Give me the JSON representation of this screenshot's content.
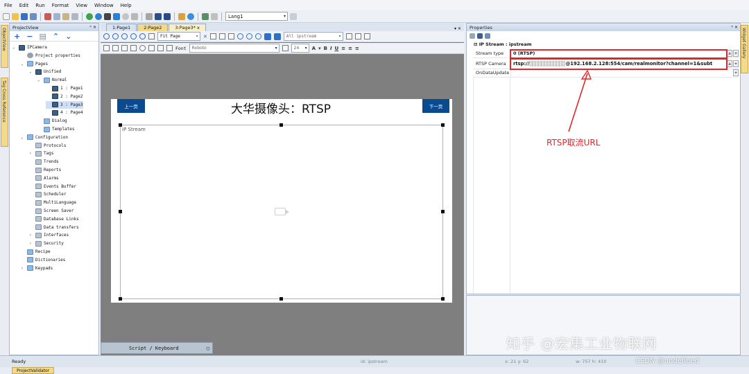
{
  "menu": [
    "File",
    "Edit",
    "Run",
    "Format",
    "View",
    "Window",
    "Help"
  ],
  "toolbar": {
    "language": "Lang1"
  },
  "side_tabs": {
    "left1": "ObjectView",
    "left2": "Tag Cross Reference",
    "right": "Widget Gallery"
  },
  "project_panel": {
    "title": "ProjectView",
    "tree": [
      {
        "label": "IPCamera",
        "level": 0,
        "exp": "v",
        "icon": "project-icon"
      },
      {
        "label": "Project properties",
        "level": 1,
        "exp": "",
        "icon": "gear-icon"
      },
      {
        "label": "Pages",
        "level": 1,
        "exp": "v",
        "icon": "folder-icon"
      },
      {
        "label": "Unified",
        "level": 2,
        "exp": "v",
        "icon": "page-group-icon"
      },
      {
        "label": "Normal",
        "level": 3,
        "exp": "v",
        "icon": "folder-icon"
      },
      {
        "label": "1 : Page1",
        "level": 4,
        "exp": "",
        "icon": "home-icon"
      },
      {
        "label": "2 : Page2",
        "level": 4,
        "exp": "",
        "icon": "page-icon"
      },
      {
        "label": "3 : Page3",
        "level": 4,
        "exp": "",
        "icon": "page-icon",
        "selected": true
      },
      {
        "label": "4 : Page4",
        "level": 4,
        "exp": "",
        "icon": "page-icon"
      },
      {
        "label": "Dialog",
        "level": 3,
        "exp": "",
        "icon": "folder-icon"
      },
      {
        "label": "Templates",
        "level": 3,
        "exp": "",
        "icon": "folder-icon"
      },
      {
        "label": "Configuration",
        "level": 1,
        "exp": "v",
        "icon": "folder-icon"
      },
      {
        "label": "Protocols",
        "level": 2,
        "exp": "",
        "icon": "protocols-icon"
      },
      {
        "label": "Tags",
        "level": 2,
        "exp": ">",
        "icon": "tags-icon"
      },
      {
        "label": "Trends",
        "level": 2,
        "exp": "",
        "icon": "trends-icon"
      },
      {
        "label": "Reports",
        "level": 2,
        "exp": "",
        "icon": "reports-icon"
      },
      {
        "label": "Alarms",
        "level": 2,
        "exp": "",
        "icon": "alarms-icon"
      },
      {
        "label": "Events Buffer",
        "level": 2,
        "exp": "",
        "icon": "events-icon"
      },
      {
        "label": "Scheduler",
        "level": 2,
        "exp": "",
        "icon": "scheduler-icon"
      },
      {
        "label": "MultiLanguage",
        "level": 2,
        "exp": "",
        "icon": "multilanguage-icon"
      },
      {
        "label": "Screen Saver",
        "level": 2,
        "exp": "",
        "icon": "screensaver-icon"
      },
      {
        "label": "Database Links",
        "level": 2,
        "exp": "",
        "icon": "database-icon"
      },
      {
        "label": "Data transfers",
        "level": 2,
        "exp": "",
        "icon": "datatransfer-icon"
      },
      {
        "label": "Interfaces",
        "level": 2,
        "exp": ">",
        "icon": "interfaces-icon"
      },
      {
        "label": "Security",
        "level": 2,
        "exp": ">",
        "icon": "security-icon"
      },
      {
        "label": "Recipe",
        "level": 1,
        "exp": "",
        "icon": "folder-icon"
      },
      {
        "label": "Dictionaries",
        "level": 1,
        "exp": "",
        "icon": "folder-icon"
      },
      {
        "label": "Keypads",
        "level": 1,
        "exp": ">",
        "icon": "folder-icon"
      }
    ]
  },
  "editor": {
    "tabs": [
      {
        "label": "1:Page1",
        "bg": "#d6e2f0"
      },
      {
        "label": "2:Page2",
        "bg": "#f3d98b"
      },
      {
        "label": "3:Page3*",
        "bg": "#f7efc9",
        "close": "x"
      }
    ],
    "zoom": "Fit Page",
    "layer": "All ipstream",
    "font_label": "Font",
    "font_name": "Roboto",
    "font_size": "24",
    "page": {
      "title": "大华摄像头：RTSP",
      "prev_button": "上一页",
      "next_button": "下一页",
      "widget_label": "IP Stream"
    },
    "script_bar": "Script / Keyboard"
  },
  "properties": {
    "title": "Properties",
    "object": "IP Stream : ipstream",
    "rows": [
      {
        "name": "Stream type",
        "value": "0 (RTSP)"
      },
      {
        "name": "RTSP Camera",
        "value": "rtsp://░░░░░░░░░░@192.168.2.128:554/cam/realmonitor?channel=1&subt"
      },
      {
        "name": "OnDataUpdate",
        "value": ""
      }
    ]
  },
  "annotation": "RTSP取流URL",
  "status": {
    "ready": "Ready",
    "object_id": "id: ipstream",
    "coords": "x: 21  y: 62",
    "size": "w: 757  h: 410"
  },
  "bottom_tab": "ProjectValidator",
  "watermark": "知乎 @宏集工业物联网",
  "watermark2": "CSDN @undefined",
  "colors": {
    "highlight": "#e0262b",
    "nav_button": "#0c4a8f",
    "canvas_bg": "#7f7f7f"
  }
}
